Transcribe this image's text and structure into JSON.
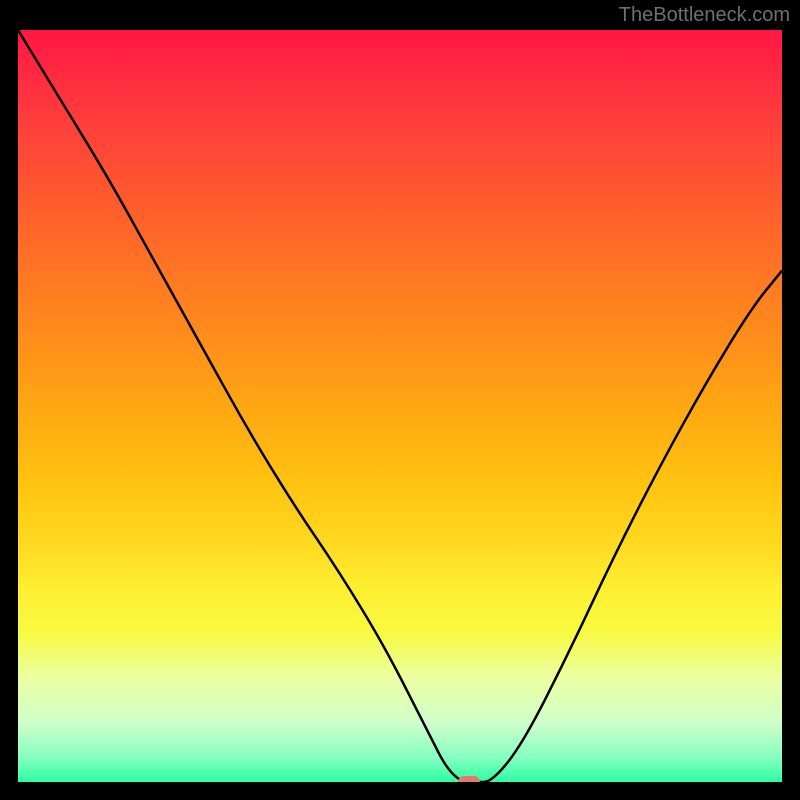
{
  "watermark": "TheBottleneck.com",
  "chart_data": {
    "type": "line",
    "title": "",
    "xlabel": "",
    "ylabel": "",
    "xlim": [
      0,
      100
    ],
    "ylim": [
      0,
      100
    ],
    "gradient": {
      "top_color": "#ff1744",
      "bottom_color": "#2affa0"
    },
    "series": [
      {
        "name": "bottleneck-curve",
        "x": [
          0,
          6,
          12,
          18,
          24,
          30,
          36,
          42,
          48,
          54,
          56,
          58,
          60,
          62,
          66,
          72,
          78,
          84,
          90,
          96,
          100
        ],
        "values": [
          100,
          90,
          80,
          69,
          58,
          47,
          37,
          28,
          18,
          6,
          2,
          0,
          0,
          0,
          5,
          17,
          30,
          42,
          53,
          63,
          68
        ],
        "color": "#000000",
        "annotations": [
          {
            "name": "optimal-marker",
            "x": 59,
            "y": 0,
            "color": "#e07a70"
          }
        ]
      }
    ]
  }
}
